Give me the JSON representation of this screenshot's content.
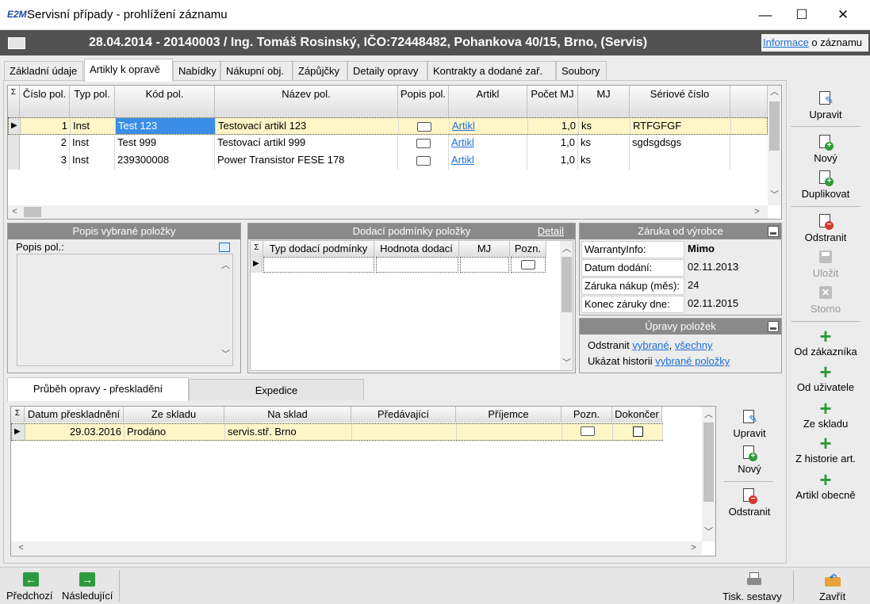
{
  "window": {
    "logo": "E2M",
    "title": "Servisní případy - prohlížení záznamu",
    "minimize": "—",
    "maximize": "☐",
    "close": "✕"
  },
  "header": {
    "title": "28.04.2014 - 20140003 / Ing. Tomáš Rosinský, IČO:72448482, Pohankova 40/15, Brno, (Servis)",
    "info_link": "Informace",
    "info_suffix": " o záznamu"
  },
  "tabs": [
    {
      "label": "Základní údaje",
      "active": false
    },
    {
      "label": "Artikly k opravě",
      "active": true
    },
    {
      "label": "Nabídky",
      "active": false
    },
    {
      "label": "Nákupní obj.",
      "active": false
    },
    {
      "label": "Zápůjčky",
      "active": false
    },
    {
      "label": "Detaily opravy",
      "active": false
    },
    {
      "label": "Kontrakty a dodané zař.",
      "active": false
    },
    {
      "label": "Soubory",
      "active": false
    }
  ],
  "items_grid": {
    "sigma": "Σ",
    "columns": [
      "Číslo pol.",
      "Typ pol.",
      "Kód pol.",
      "Název pol.",
      "Popis pol.",
      "Artikl",
      "Počet MJ",
      "MJ",
      "Sériové číslo"
    ],
    "rows": [
      {
        "cislo": "1",
        "typ": "Inst",
        "kod": "Test 123",
        "nazev": "Testovací artikl 123",
        "artikl": "Artikl",
        "pocet": "1,0",
        "mj": "ks",
        "seriove": "RTFGFGF",
        "selected": true
      },
      {
        "cislo": "2",
        "typ": "Inst",
        "kod": "Test 999",
        "nazev": "Testovací artikl 999",
        "artikl": "Artikl",
        "pocet": "1,0",
        "mj": "ks",
        "seriove": "sgdsgdsgs",
        "selected": false
      },
      {
        "cislo": "3",
        "typ": "Inst",
        "kod": "239300008",
        "nazev": "Power Transistor FESE 178",
        "artikl": "Artikl",
        "pocet": "1,0",
        "mj": "ks",
        "seriove": "",
        "selected": false
      }
    ]
  },
  "popis_panel": {
    "title": "Popis vybrané položky",
    "label": "Popis pol.:"
  },
  "dodaci_panel": {
    "title": "Dodací podmínky položky",
    "detail_link": "Detail",
    "sigma": "Σ",
    "columns": [
      "Typ dodací podmínky",
      "Hodnota dodací",
      "MJ",
      "Pozn."
    ]
  },
  "zaruka_panel": {
    "title": "Záruka od výrobce",
    "rows": [
      {
        "label": "WarrantyInfo:",
        "value": "Mimo",
        "bold": true
      },
      {
        "label": "Datum dodání:",
        "value": "02.11.2013",
        "bold": false
      },
      {
        "label": "Záruka nákup (měs):",
        "value": "24",
        "bold": false
      },
      {
        "label": "Konec záruky dne:",
        "value": "02.11.2015",
        "bold": false
      }
    ]
  },
  "upravy_panel": {
    "title": "Úpravy položek",
    "line1_prefix": "Odstranit ",
    "line1_link1": "vybrané",
    "line1_sep": ", ",
    "line1_link2": "všechny",
    "line2_prefix": "Ukázat historii ",
    "line2_link": "vybrané položky"
  },
  "bottom_tabs": [
    {
      "label": "Průběh opravy - přeskladění",
      "active": true
    },
    {
      "label": "Expedice",
      "active": false
    }
  ],
  "transfer_grid": {
    "sigma": "Σ",
    "columns": [
      "Datum přeskladnění",
      "Ze skladu",
      "Na sklad",
      "Předávající",
      "Příjemce",
      "Pozn.",
      "Dokončer"
    ],
    "rows": [
      {
        "datum": "29.03.2016",
        "ze": "Prodáno",
        "na": "servis.stř. Brno",
        "predavajici": "",
        "prijemce": ""
      }
    ]
  },
  "transfer_toolbar": {
    "edit": "Upravit",
    "new": "Nový",
    "delete": "Odstranit"
  },
  "right_toolbar": {
    "edit": "Upravit",
    "new": "Nový",
    "duplicate": "Duplikovat",
    "delete": "Odstranit",
    "save": "Uložit",
    "cancel": "Storno",
    "from_customer": "Od zákazníka",
    "from_user": "Od uživatele",
    "from_stock": "Ze skladu",
    "from_history": "Z historie art.",
    "general_article": "Artikl obecně"
  },
  "bottom_bar": {
    "prev": "Předchozí",
    "next": "Následující",
    "print": "Tisk. sestavy",
    "close": "Zavřít"
  },
  "colors": {
    "header_bg": "#525252",
    "panel_title_bg": "#8a8a8a",
    "selected_row": "#fff6c8",
    "link": "#1f6fd6",
    "green": "#2e9a3e",
    "red": "#d33a2c"
  }
}
